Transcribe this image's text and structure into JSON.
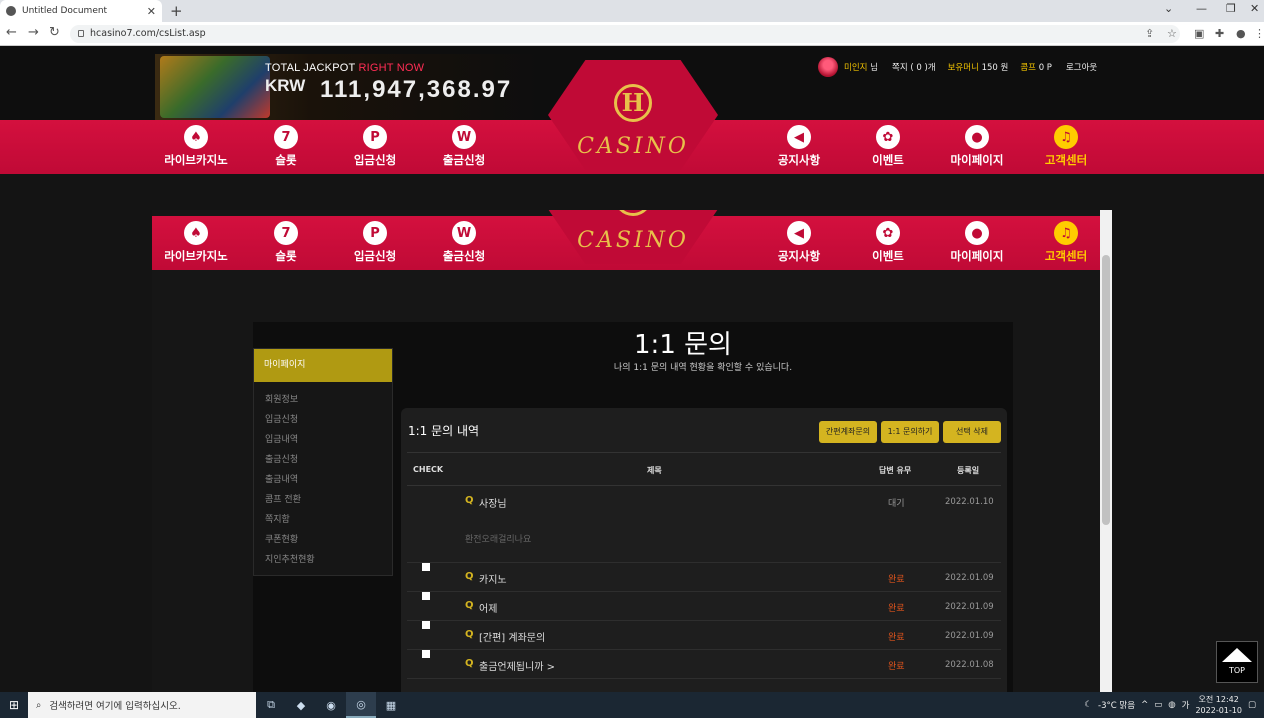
{
  "browser": {
    "tab_title": "Untitled Document",
    "url": "hcasino7.com/csList.asp",
    "new_tab": "+",
    "min": "—",
    "max": "❐",
    "close": "✕"
  },
  "jackpot": {
    "title_a": "TOTAL JACKPOT",
    "title_b": "RIGHT NOW",
    "currency": "KRW",
    "amount": "111,947,368.97"
  },
  "user": {
    "name": "미인지",
    "suffix": "님",
    "messages": "쪽지 ( 0 )개",
    "money_label": "보유머니",
    "money_value": "150 원",
    "comp_label": "콤프",
    "comp_value": "0 P",
    "logout": "로그아웃"
  },
  "menu": {
    "left": [
      {
        "label": "라이브카지노",
        "icon": "♠"
      },
      {
        "label": "슬롯",
        "icon": "7"
      },
      {
        "label": "입금신청",
        "icon": "P"
      },
      {
        "label": "출금신청",
        "icon": "W"
      }
    ],
    "right": [
      {
        "label": "공지사항",
        "icon": "◀"
      },
      {
        "label": "이벤트",
        "icon": "✿"
      },
      {
        "label": "마이페이지",
        "icon": "●"
      },
      {
        "label": "고객센터",
        "icon": "♫"
      }
    ]
  },
  "logo": {
    "letter": "H",
    "script": "CASINO"
  },
  "page": {
    "title": "1:1 문의",
    "subtitle": "나의 1:1 문의 내역 현황을 확인할 수 있습니다."
  },
  "sidebar": {
    "title": "마이페이지",
    "items": [
      "회원정보",
      "입금신청",
      "입금내역",
      "출금신청",
      "출금내역",
      "콤프 전환",
      "쪽지함",
      "쿠폰현황",
      "지인추천현황"
    ]
  },
  "panel": {
    "title": "1:1 문의 내역",
    "btn_account": "간편계좌문의",
    "btn_inquiry": "1:1 문의하기",
    "btn_delete": "선택 삭제",
    "columns": {
      "check": "CHECK",
      "subject": "제목",
      "status": "답변 유무",
      "date": "등록일"
    },
    "rows": [
      {
        "subject": "사장님",
        "status": "대기",
        "date": "2022.01.10",
        "preview": "환전오래걸리나요"
      },
      {
        "subject": "카지노",
        "status": "완료",
        "date": "2022.01.09"
      },
      {
        "subject": "어제",
        "status": "완료",
        "date": "2022.01.09"
      },
      {
        "subject": "[간편] 계좌문의",
        "status": "완료",
        "date": "2022.01.09"
      },
      {
        "subject": "출금언제됩니까 >",
        "status": "완료",
        "date": "2022.01.08"
      }
    ],
    "q_icon": "Q"
  },
  "top_button": "TOP",
  "taskbar": {
    "search_placeholder": "검색하려면 여기에 입력하십시오.",
    "weather": "-3°C 맑음",
    "time": "오전 12:42",
    "date": "2022-01-10"
  },
  "colors": {
    "accent_red": "#c00a36",
    "gold": "#d4b420"
  }
}
